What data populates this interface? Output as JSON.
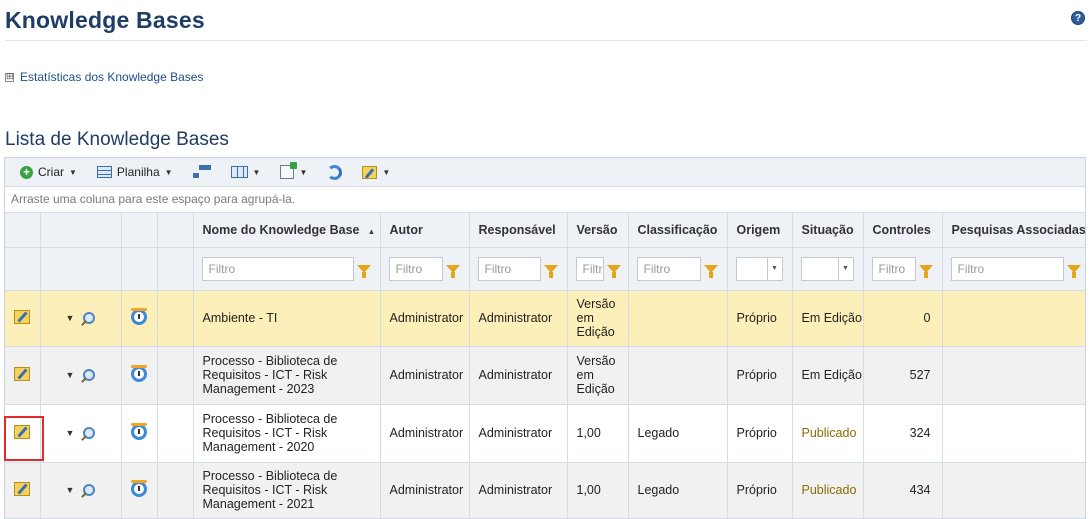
{
  "page": {
    "title": "Knowledge Bases",
    "help_icon": "?",
    "stats_toggle": "⊞",
    "stats_link": "Estatísticas dos Knowledge Bases",
    "section_title": "Lista de Knowledge Bases"
  },
  "toolbar": {
    "create_label": "Criar",
    "sheet_label": "Planilha",
    "icons": [
      "create-icon",
      "spreadsheet-icon",
      "hierarchy-icon",
      "columns-icon",
      "export-icon",
      "refresh-icon",
      "edit-icon"
    ]
  },
  "grid": {
    "group_hint": "Arraste uma coluna para este espaço para agrupá-la.",
    "columns": [
      "Nome do Knowledge Base",
      "Autor",
      "Responsável",
      "Versão",
      "Classificação",
      "Origem",
      "Situação",
      "Controles",
      "Pesquisas Associadas"
    ],
    "sort_indicator": "▲",
    "filter_placeholder": "Filtro",
    "rows": [
      {
        "name": "Ambiente - TI",
        "author": "Administrator",
        "owner": "Administrator",
        "version": "Versão em Edição",
        "classification": "",
        "origin": "Próprio",
        "status": "Em Edição",
        "controls": "0",
        "surveys": ""
      },
      {
        "name": "Processo - Biblioteca de Requisitos - ICT - Risk Management - 2023",
        "author": "Administrator",
        "owner": "Administrator",
        "version": "Versão em Edição",
        "classification": "",
        "origin": "Próprio",
        "status": "Em Edição",
        "controls": "527",
        "surveys": ""
      },
      {
        "name": "Processo - Biblioteca de Requisitos - ICT - Risk Management - 2020",
        "author": "Administrator",
        "owner": "Administrator",
        "version": "1,00",
        "classification": "Legado",
        "origin": "Próprio",
        "status": "Publicado",
        "controls": "324",
        "surveys": ""
      },
      {
        "name": "Processo - Biblioteca de Requisitos - ICT - Risk Management - 2021",
        "author": "Administrator",
        "owner": "Administrator",
        "version": "1,00",
        "classification": "Legado",
        "origin": "Próprio",
        "status": "Publicado",
        "controls": "434",
        "surveys": ""
      }
    ]
  },
  "colors": {
    "title": "#1f3d66",
    "selected_row": "#fcefb9",
    "published_status": "#8c6c00",
    "highlight_box": "#e02b2b"
  }
}
